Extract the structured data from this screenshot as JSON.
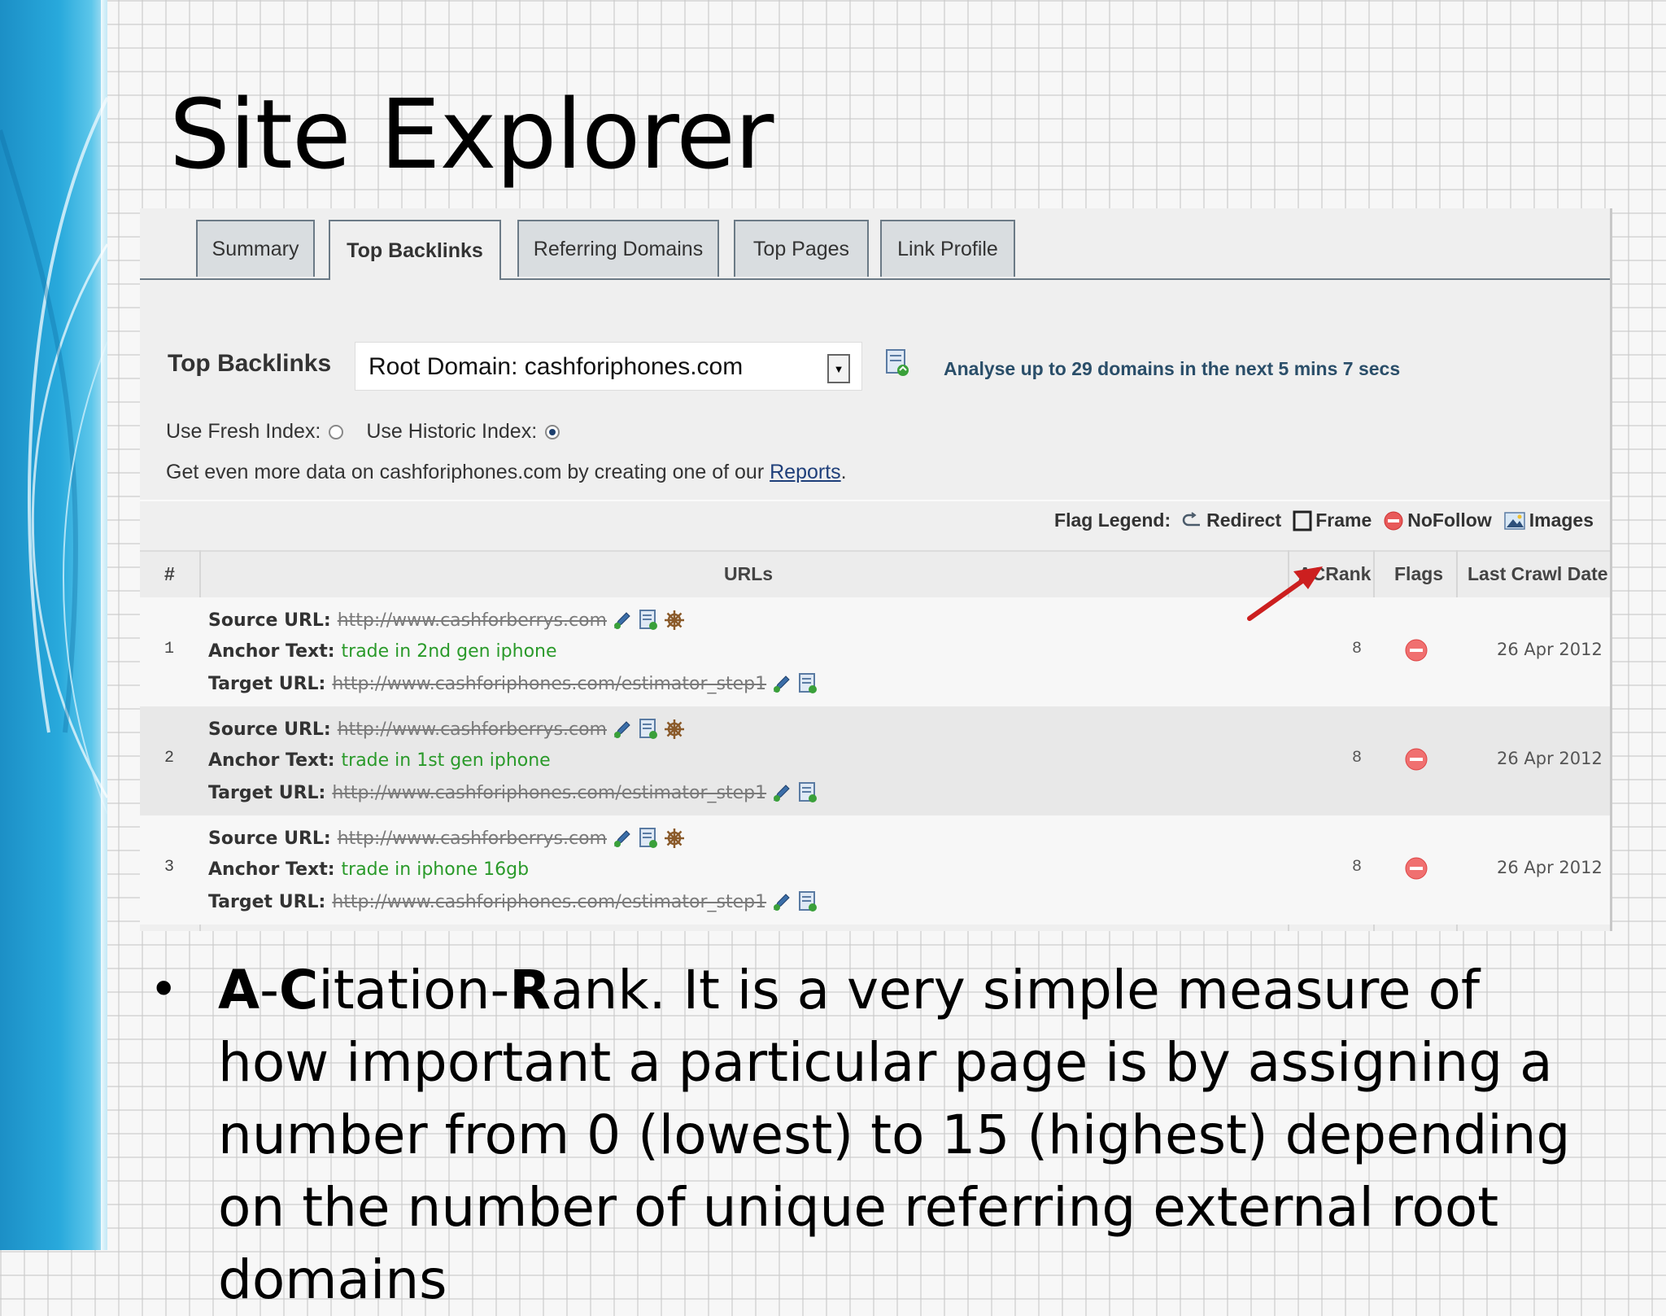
{
  "slide": {
    "title": "Site Explorer"
  },
  "tabs": [
    {
      "label": "Summary"
    },
    {
      "label": "Top Backlinks"
    },
    {
      "label": "Referring Domains"
    },
    {
      "label": "Top Pages"
    },
    {
      "label": "Link Profile"
    }
  ],
  "controls": {
    "heading": "Top Backlinks",
    "domain_select": "Root Domain: cashforiphones.com",
    "analyse_text": "Analyse up to 29 domains in the next 5 mins 7 secs",
    "fresh_index_label": "Use Fresh Index:",
    "historic_index_label": "Use Historic Index:",
    "selected_index": "historic",
    "more_data_prefix": "Get even more data on cashforiphones.com by creating one of our ",
    "reports_link": "Reports",
    "more_data_suffix": "."
  },
  "legend": {
    "title": "Flag Legend:",
    "redirect": "Redirect",
    "frame": "Frame",
    "nofollow": "NoFollow",
    "images": "Images"
  },
  "table": {
    "columns": {
      "num": "#",
      "urls": "URLs",
      "rank": "ACRank",
      "flags": "Flags",
      "date": "Last Crawl Date"
    },
    "labels": {
      "source": "Source URL:",
      "anchor": "Anchor Text:",
      "target": "Target URL:"
    },
    "rows": [
      {
        "num": "1",
        "source": "http://www.cashforberrys.com",
        "anchor": "trade in 2nd gen iphone",
        "target": "http://www.cashforiphones.com/estimator_step1",
        "rank": "8",
        "date": "26 Apr 2012"
      },
      {
        "num": "2",
        "source": "http://www.cashforberrys.com",
        "anchor": "trade in 1st gen iphone",
        "target": "http://www.cashforiphones.com/estimator_step1",
        "rank": "8",
        "date": "26 Apr 2012"
      },
      {
        "num": "3",
        "source": "http://www.cashforberrys.com",
        "anchor": "trade in iphone 16gb",
        "target": "http://www.cashforiphones.com/estimator_step1",
        "rank": "8",
        "date": "26 Apr 2012"
      }
    ]
  },
  "bullet": {
    "a": "A",
    "dash1": "-",
    "c": "C",
    "itation": "itation",
    "dash2": "-",
    "r": "R",
    "rest": "ank. It is a very simple measure of how important a particular page is by assigning a number from 0 (lowest) to 15 (highest) depending on the number of unique referring external root domains"
  },
  "colors": {
    "accent": "#28a9dc",
    "anchor_text": "#2a9a2a",
    "arrow": "#cc1f1f",
    "nofollow": "#e05555"
  }
}
